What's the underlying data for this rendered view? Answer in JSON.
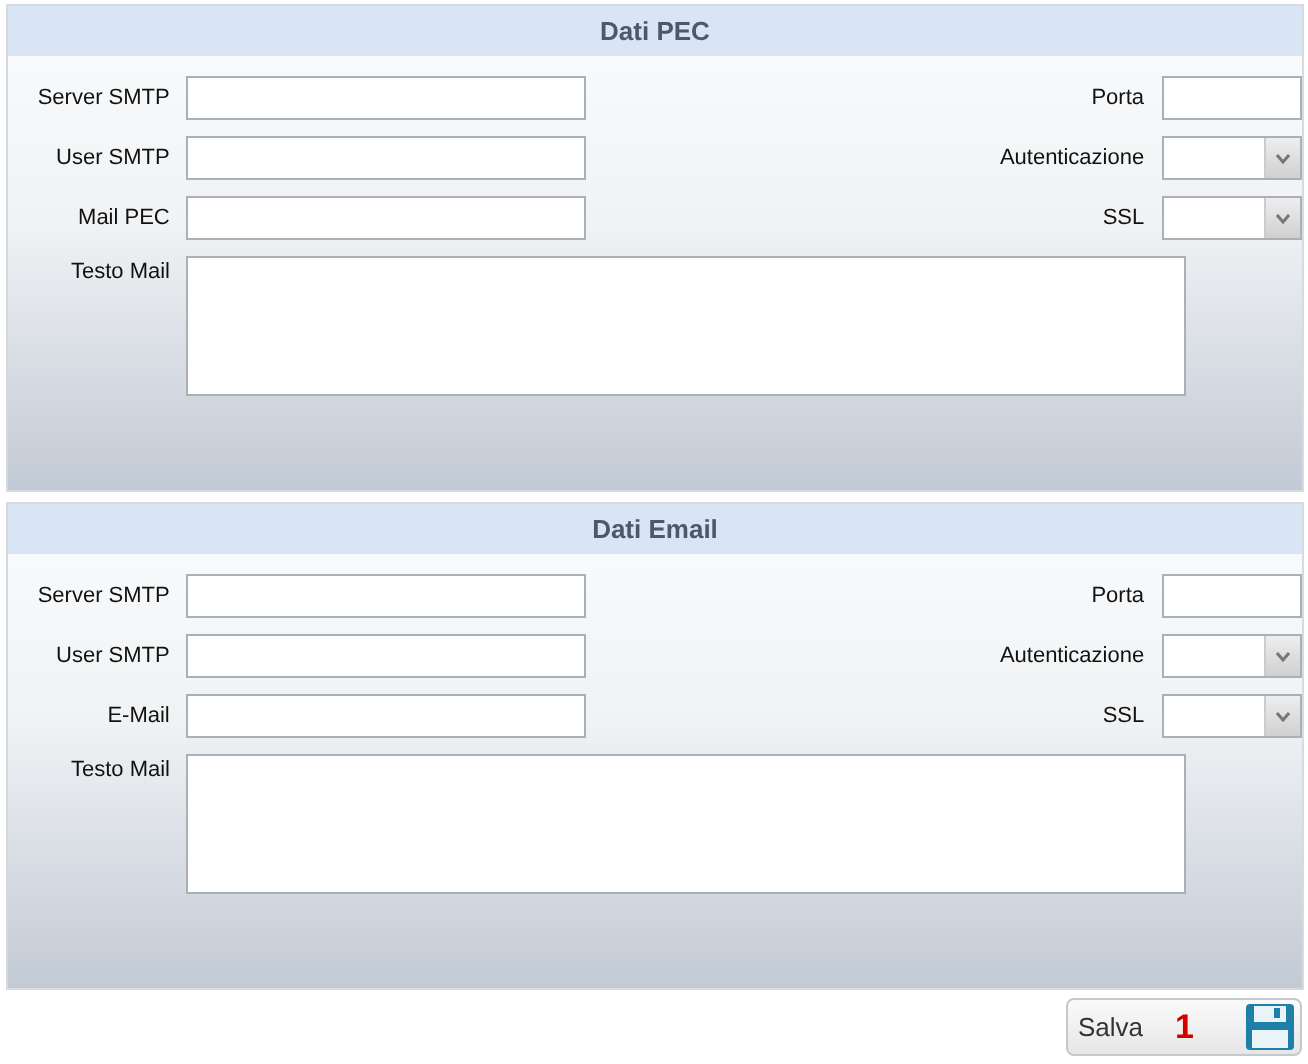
{
  "sections": [
    {
      "title": "Dati PEC",
      "rows": [
        [
          {
            "label": "Server SMTP",
            "kind": "text"
          },
          {
            "label": "Porta",
            "kind": "short"
          }
        ],
        [
          {
            "label": "User SMTP",
            "kind": "text"
          },
          {
            "label": "Autenticazione",
            "kind": "select"
          }
        ],
        [
          {
            "label": "Mail PEC",
            "kind": "text"
          },
          {
            "label": "SSL",
            "kind": "select"
          }
        ]
      ],
      "message": {
        "label": "Testo Mail"
      }
    },
    {
      "title": "Dati Email",
      "rows": [
        [
          {
            "label": "Server SMTP",
            "kind": "text"
          },
          {
            "label": "Porta",
            "kind": "short"
          }
        ],
        [
          {
            "label": "User SMTP",
            "kind": "text"
          },
          {
            "label": "Autenticazione",
            "kind": "select"
          }
        ],
        [
          {
            "label": "E-Mail",
            "kind": "text"
          },
          {
            "label": "SSL",
            "kind": "select"
          }
        ]
      ],
      "message": {
        "label": "Testo Mail"
      }
    }
  ],
  "save_button": {
    "label": "Salva",
    "annotation": "1"
  }
}
